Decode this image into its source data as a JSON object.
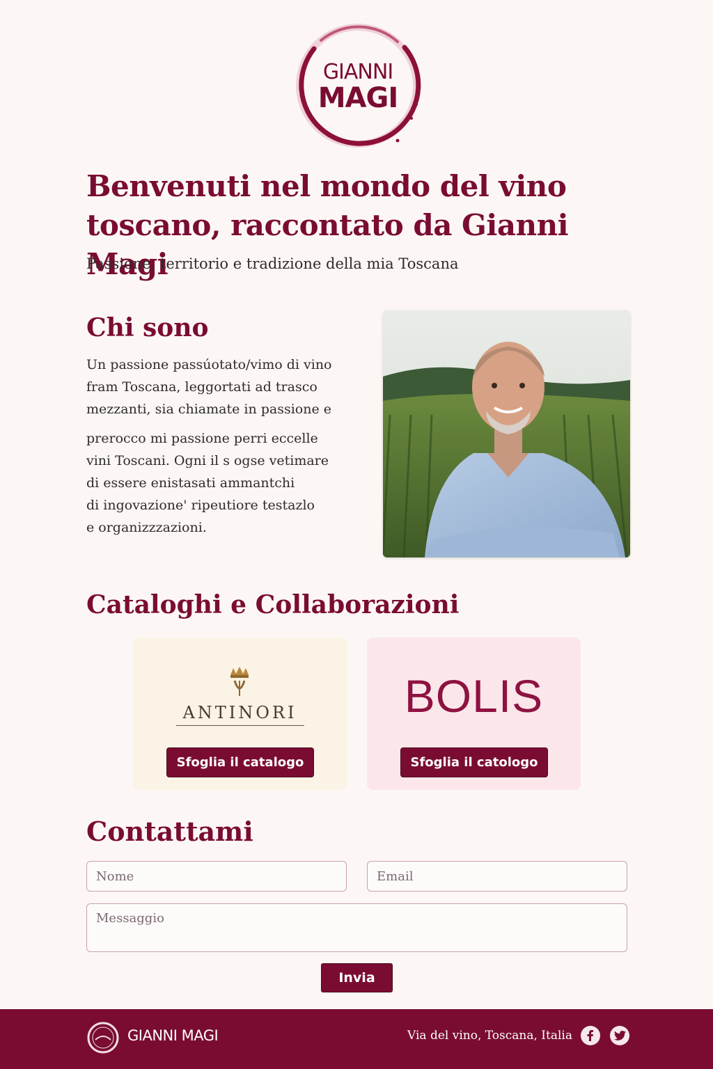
{
  "brand": {
    "logo_line1": "GIANNI",
    "logo_line2": "MAGI",
    "accent": "#7a0c32"
  },
  "hero": {
    "title_line1": "Benvenuti nel mondo del vino",
    "title_line2": "toscano, raccontato da Gianni Magi",
    "subtitle": "Passione, territorio e tradizione della mia Toscana"
  },
  "about": {
    "title": "Chi sono",
    "lines": [
      "Un passione passúotato/vimo di vino",
      "fram Toscana, leggortati ad trasco",
      "mezzanti, sia chiamate in passione e",
      "prerocco mi passione perri eccelle",
      "vini Toscani. Ogni il s ogse vetimare",
      "di essere enistasati ammantchi",
      "di ingovazione' ripeutiore  testazlo",
      "e organizzzazioni."
    ],
    "photo_icon": "portrait-photo"
  },
  "catalogs": {
    "title": "Cataloghi e Collaborazioni",
    "items": [
      {
        "brand": "ANTINORI",
        "button": "Sfoglia il catalogo"
      },
      {
        "brand": "BOLIS",
        "button": "Sfoglia il catologo"
      }
    ]
  },
  "contact": {
    "title": "Contattami",
    "name_placeholder": "Nome",
    "email_placeholder": "Email",
    "message_placeholder": "Messaggio",
    "submit": "Invia"
  },
  "footer": {
    "brand": "GIANNI MAGI",
    "address": "Via del vino, Toscana, Italia",
    "icons": [
      "facebook-icon",
      "twitter-icon"
    ]
  }
}
